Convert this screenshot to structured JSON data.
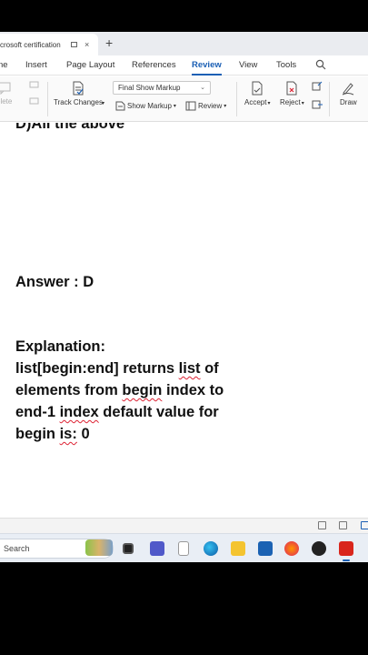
{
  "tab": {
    "title": "crosoft certification",
    "close": "×",
    "new_tab": "+"
  },
  "menu": {
    "items": [
      "ne",
      "Insert",
      "Page Layout",
      "References",
      "Review",
      "View",
      "Tools"
    ],
    "active": "Review"
  },
  "ribbon": {
    "delete_label": "elete",
    "track_changes_label": "Track Changes",
    "markup_mode": "Final Show Markup",
    "show_markup_label": "Show Markup",
    "review_label": "Review",
    "accept_label": "Accept",
    "reject_label": "Reject",
    "draw_label": "Draw"
  },
  "document": {
    "prev_line": "D)All the above",
    "answer": "Answer : D",
    "explanation_heading": "Explanation:",
    "line1_a": "list[begin:end] returns ",
    "line1_b": "list",
    "line1_c": " of",
    "line2_a": "elements from ",
    "line2_b": "begin",
    "line2_c": " index to",
    "line3_a": "end-1 ",
    "line3_b": "index",
    "line3_c": " default value for",
    "line4_a": "begin ",
    "line4_b": "is:",
    "line4_c": " 0"
  },
  "taskbar": {
    "search_placeholder": "Search"
  },
  "colors": {
    "accent": "#1a5fb4",
    "squiggle": "#dd2233"
  }
}
